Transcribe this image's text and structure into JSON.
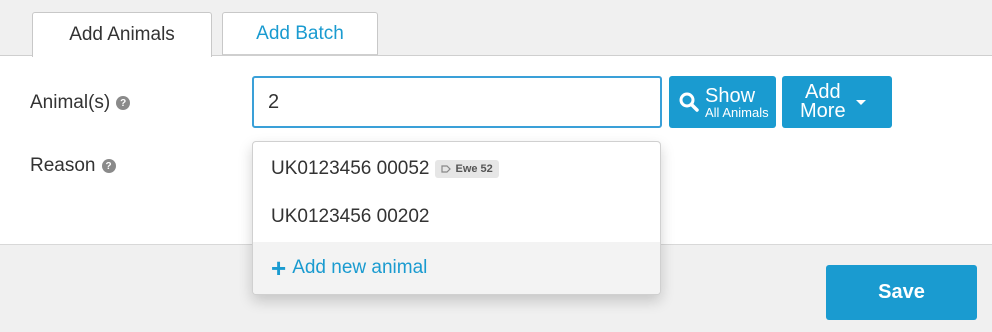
{
  "tabs": [
    {
      "label": "Add Animals",
      "active": true
    },
    {
      "label": "Add Batch",
      "active": false
    }
  ],
  "form": {
    "animals_label": "Animal(s)",
    "reason_label": "Reason",
    "help_glyph": "?",
    "animal_input_value": "2",
    "show_button": {
      "line1": "Show",
      "line2": "All Animals",
      "icon": "search-icon"
    },
    "add_more_button": {
      "line1": "Add",
      "line2": "More"
    }
  },
  "dropdown": {
    "items": [
      {
        "id": "UK0123456 00052",
        "tag": "Ewe 52",
        "tag_icon": "tag-icon"
      },
      {
        "id": "UK0123456 00202"
      }
    ],
    "add_new_label": "Add new animal"
  },
  "footer": {
    "save_label": "Save"
  },
  "colors": {
    "accent": "#1a9bd0",
    "input_border": "#3aa0d8",
    "panel_bg": "#f0f0f0"
  }
}
